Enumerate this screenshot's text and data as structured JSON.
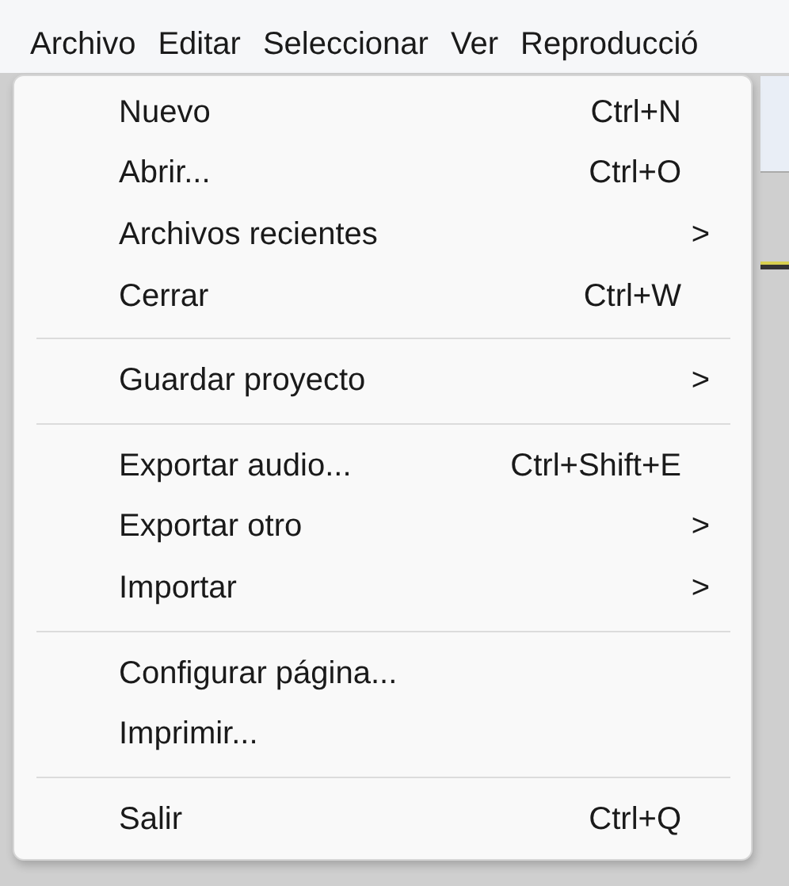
{
  "menubar": [
    {
      "label": "Archivo"
    },
    {
      "label": "Editar"
    },
    {
      "label": "Seleccionar"
    },
    {
      "label": "Ver"
    },
    {
      "label": "Reproducció"
    }
  ],
  "menu": {
    "sections": [
      [
        {
          "kind": "shortcut",
          "label": "Nuevo",
          "shortcut": "Ctrl+N"
        },
        {
          "kind": "shortcut",
          "label": "Abrir...",
          "shortcut": "Ctrl+O"
        },
        {
          "kind": "submenu",
          "label": "Archivos recientes",
          "arrow": ">"
        },
        {
          "kind": "shortcut",
          "label": "Cerrar",
          "shortcut": "Ctrl+W"
        }
      ],
      [
        {
          "kind": "submenu",
          "label": "Guardar proyecto",
          "arrow": ">"
        }
      ],
      [
        {
          "kind": "shortcut",
          "label": "Exportar audio...",
          "shortcut": "Ctrl+Shift+E"
        },
        {
          "kind": "submenu",
          "label": "Exportar otro",
          "arrow": ">"
        },
        {
          "kind": "submenu",
          "label": "Importar",
          "arrow": ">"
        }
      ],
      [
        {
          "kind": "plain",
          "label": "Configurar página..."
        },
        {
          "kind": "plain",
          "label": "Imprimir..."
        }
      ],
      [
        {
          "kind": "shortcut",
          "label": "Salir",
          "shortcut": "Ctrl+Q"
        }
      ]
    ]
  }
}
